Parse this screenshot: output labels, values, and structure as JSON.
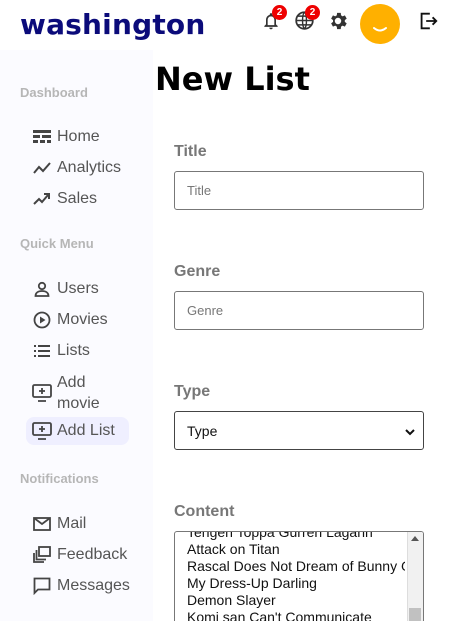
{
  "app": {
    "logo": "washington"
  },
  "topbar": {
    "notifications_badge": "2",
    "language_badge": "2"
  },
  "sidebar": {
    "sections": [
      {
        "title": "Dashboard",
        "items": [
          {
            "label": "Home",
            "icon": "dashboard-icon"
          },
          {
            "label": "Analytics",
            "icon": "timeline-icon"
          },
          {
            "label": "Sales",
            "icon": "trending-up-icon"
          }
        ]
      },
      {
        "title": "Quick Menu",
        "items": [
          {
            "label": "Users",
            "icon": "person-icon"
          },
          {
            "label": "Movies",
            "icon": "play-circle-icon"
          },
          {
            "label": "Lists",
            "icon": "list-icon"
          },
          {
            "label": "Add movie",
            "icon": "add-to-queue-icon"
          },
          {
            "label": "Add List",
            "icon": "add-to-queue-icon",
            "active": true
          }
        ]
      },
      {
        "title": "Notifications",
        "items": [
          {
            "label": "Mail",
            "icon": "mail-icon"
          },
          {
            "label": "Feedback",
            "icon": "feedback-icon"
          },
          {
            "label": "Messages",
            "icon": "chat-icon"
          }
        ]
      }
    ]
  },
  "main": {
    "title": "New List",
    "form": {
      "title_label": "Title",
      "title_placeholder": "Title",
      "genre_label": "Genre",
      "genre_placeholder": "Genre",
      "type_label": "Type",
      "type_selected": "Type",
      "content_label": "Content",
      "content_options": [
        "Tengen Toppa Gurren Lagann",
        "Attack on Titan",
        "Rascal Does Not Dream of Bunny Girl Senpai",
        "My Dress-Up Darling",
        "Demon Slayer",
        "Komi san Can't Communicate"
      ]
    }
  },
  "colors": {
    "logo": "#0b0b7a",
    "avatar": "#ffb000",
    "badge": "#e00000",
    "active_item_bg": "#efefff",
    "sidebar_bg": "#fbfbff"
  }
}
